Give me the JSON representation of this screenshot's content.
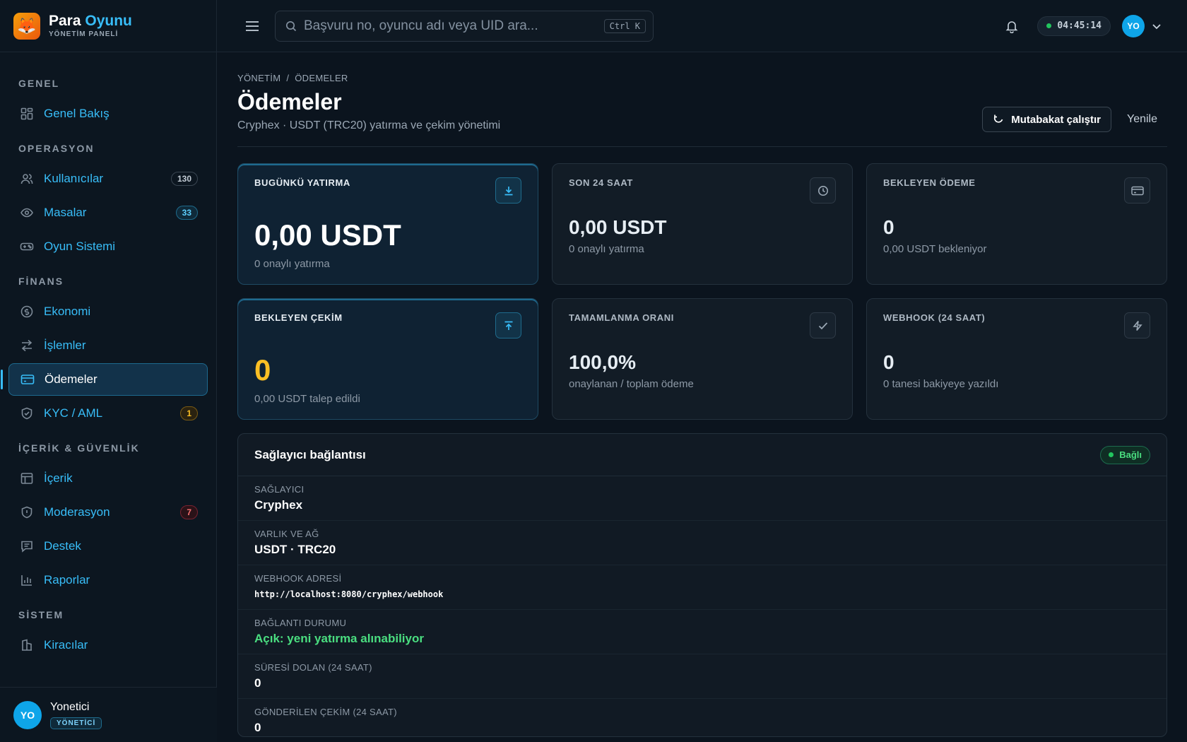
{
  "brand": {
    "name_1": "Para",
    "name_2": "Oyunu",
    "subtitle": "YÖNETİM PANELİ",
    "logo_glyph": "🦊"
  },
  "sidebar": {
    "sections": [
      {
        "title": "GENEL",
        "items": [
          {
            "label": "Genel Bakış",
            "icon": "grid-icon"
          }
        ]
      },
      {
        "title": "OPERASYON",
        "items": [
          {
            "label": "Kullanıcılar",
            "icon": "users-icon",
            "badge": "130"
          },
          {
            "label": "Masalar",
            "icon": "eye-icon",
            "badge": "33"
          },
          {
            "label": "Oyun Sistemi",
            "icon": "gamepad-icon"
          }
        ]
      },
      {
        "title": "FİNANS",
        "items": [
          {
            "label": "Ekonomi",
            "icon": "coin-icon"
          },
          {
            "label": "İşlemler",
            "icon": "transfer-icon"
          },
          {
            "label": "Ödemeler",
            "icon": "card-icon",
            "active": true
          },
          {
            "label": "KYC / AML",
            "icon": "shield-check-icon",
            "badge": "1"
          }
        ]
      },
      {
        "title": "İÇERİK & GÜVENLİK",
        "items": [
          {
            "label": "İçerik",
            "icon": "layout-icon"
          },
          {
            "label": "Moderasyon",
            "icon": "shield-alert-icon",
            "badge": "7"
          },
          {
            "label": "Destek",
            "icon": "message-icon"
          },
          {
            "label": "Raporlar",
            "icon": "bar-chart-icon"
          }
        ]
      },
      {
        "title": "SİSTEM",
        "items": [
          {
            "label": "Kiracılar",
            "icon": "building-icon"
          }
        ]
      }
    ]
  },
  "user": {
    "initials": "YO",
    "name": "Yonetici",
    "role": "YÖNETİCİ"
  },
  "topbar": {
    "search_placeholder": "Başvuru no, oyuncu adı veya UID ara...",
    "shortcut": "Ctrl K",
    "clock": "04:45:14",
    "avatar_initials": "YO"
  },
  "breadcrumb": {
    "root": "YÖNETİM",
    "separator": "/",
    "current": "ÖDEMELER"
  },
  "page": {
    "title": "Ödemeler",
    "subtitle": "Cryphex · USDT (TRC20) yatırma ve çekim yönetimi",
    "reconcile_button": "Mutabakat çalıştır",
    "refresh_button": "Yenile"
  },
  "cards": [
    {
      "label": "BUGÜNKÜ YATIRMA",
      "value": "0,00 USDT",
      "note": "0 onaylı yatırma",
      "icon": "download-icon",
      "highlight": true
    },
    {
      "label": "SON 24 SAAT",
      "value": "0,00 USDT",
      "note": "0 onaylı yatırma",
      "icon": "clock-icon"
    },
    {
      "label": "BEKLEYEN ÖDEME",
      "value": "0",
      "note": "0,00 USDT bekleniyor",
      "icon": "card-icon"
    },
    {
      "label": "BEKLEYEN ÇEKİM",
      "value": "0",
      "note": "0,00 USDT talep edildi",
      "icon": "upload-icon",
      "highlight": true
    },
    {
      "label": "TAMAMLANMA ORANI",
      "value": "100,0%",
      "note": "onaylanan / toplam ödeme",
      "icon": "check-icon"
    },
    {
      "label": "WEBHOOK (24 SAAT)",
      "value": "0",
      "note": "0 tanesi bakiyeye yazıldı",
      "icon": "bolt-icon"
    }
  ],
  "provider": {
    "title": "Sağlayıcı bağlantısı",
    "status": "Bağlı",
    "rows": [
      {
        "label": "SAĞLAYICI",
        "value": "Cryphex"
      },
      {
        "label": "VARLIK VE AĞ",
        "value": "USDT · TRC20"
      },
      {
        "label": "WEBHOOK ADRESİ",
        "value": "http://localhost:8080/cryphex/webhook"
      },
      {
        "label": "BAĞLANTI DURUMU",
        "value": "Açık: yeni yatırma alınabiliyor"
      },
      {
        "label": "SÜRESİ DOLAN (24 SAAT)",
        "value": "0"
      },
      {
        "label": "GÖNDERİLEN ÇEKİM (24 SAAT)",
        "value": "0"
      }
    ]
  },
  "colors": {
    "accent": "#38bdf8",
    "success": "#4ade80",
    "warning": "#fbbf24",
    "danger": "#f87171",
    "background": "#0b141e"
  }
}
